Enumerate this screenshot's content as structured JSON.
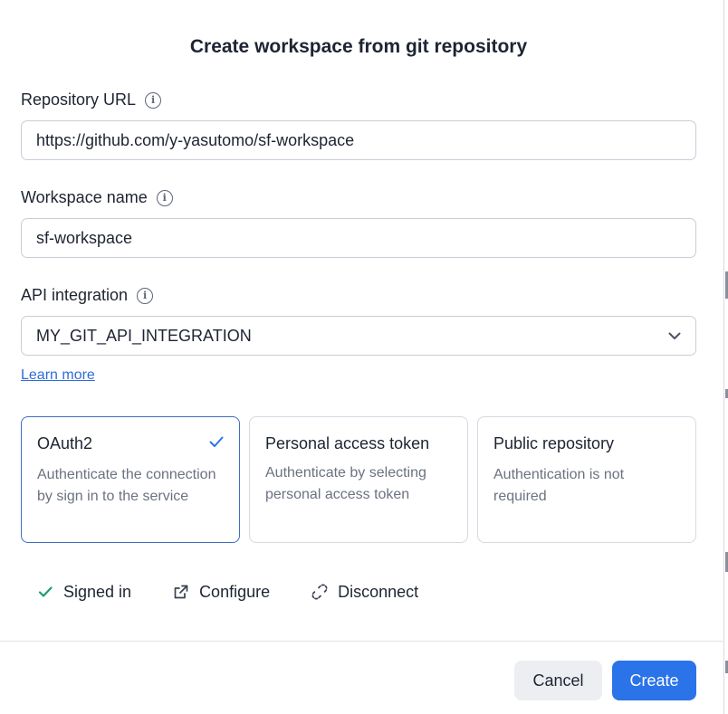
{
  "dialog": {
    "title": "Create workspace from git repository"
  },
  "fields": {
    "repository_url": {
      "label": "Repository URL",
      "value": "https://github.com/y-yasutomo/sf-workspace"
    },
    "workspace_name": {
      "label": "Workspace name",
      "value": "sf-workspace"
    },
    "api_integration": {
      "label": "API integration",
      "selected": "MY_GIT_API_INTEGRATION"
    }
  },
  "learn_more": "Learn more",
  "auth_options": [
    {
      "title": "OAuth2",
      "description": "Authenticate the connection by sign in to the service",
      "selected": true
    },
    {
      "title": "Personal access token",
      "description": "Authenticate by selecting personal access token",
      "selected": false
    },
    {
      "title": "Public repository",
      "description": "Authentication is not required",
      "selected": false
    }
  ],
  "status": {
    "signed_in": "Signed in",
    "configure": "Configure",
    "disconnect": "Disconnect"
  },
  "buttons": {
    "cancel": "Cancel",
    "create": "Create"
  },
  "colors": {
    "accent": "#2a73e8",
    "selected_border": "#3a6fc2",
    "success": "#1f9d6b",
    "link": "#2f6cd6"
  }
}
